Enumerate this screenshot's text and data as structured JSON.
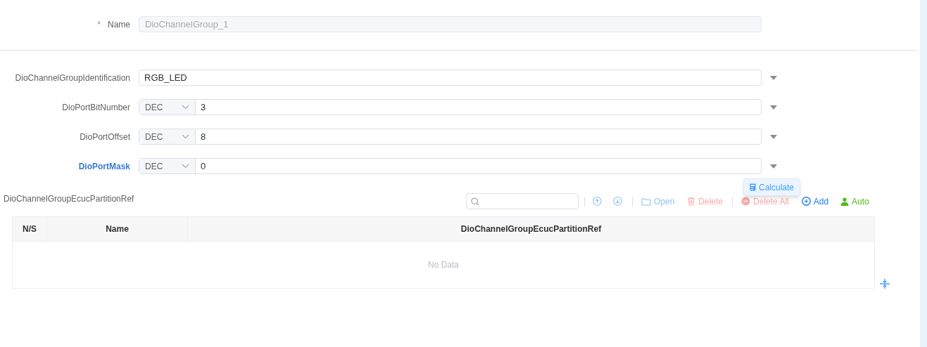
{
  "name_field": {
    "label": "Name",
    "required_mark": "*",
    "disabled": true,
    "value": "DioChannelGroup_1"
  },
  "params": [
    {
      "label": "DioChannelGroupIdentification",
      "selected": false,
      "value": "RGB_LED"
    },
    {
      "label": "DioPortBitNumber",
      "selected": false,
      "prefix": "DEC",
      "value": "3"
    },
    {
      "label": "DioPortOffset",
      "selected": false,
      "prefix": "DEC",
      "value": "8"
    },
    {
      "label": "DioPortMask",
      "selected": true,
      "prefix": "DEC",
      "value": "0"
    }
  ],
  "popup": {
    "label": "Calculate"
  },
  "reference": {
    "label": "DioChannelGroupEcucPartitionRef",
    "toolbar": [
      {
        "kind": "up",
        "disabled": true
      },
      {
        "kind": "down",
        "disabled": true
      },
      {
        "kind": "open",
        "label": "Open",
        "disabled": true
      },
      {
        "kind": "delete",
        "label": "Delete",
        "disabled": true
      },
      {
        "kind": "delete_all",
        "label": "Delete All",
        "disabled": true
      },
      {
        "kind": "add",
        "label": "Add",
        "disabled": false
      },
      {
        "kind": "auto",
        "label": "Auto",
        "disabled": false
      }
    ],
    "table": {
      "columns": [
        "N/S",
        "Name",
        "DioChannelGroupEcucPartitionRef"
      ],
      "empty_text": "No Data"
    }
  }
}
